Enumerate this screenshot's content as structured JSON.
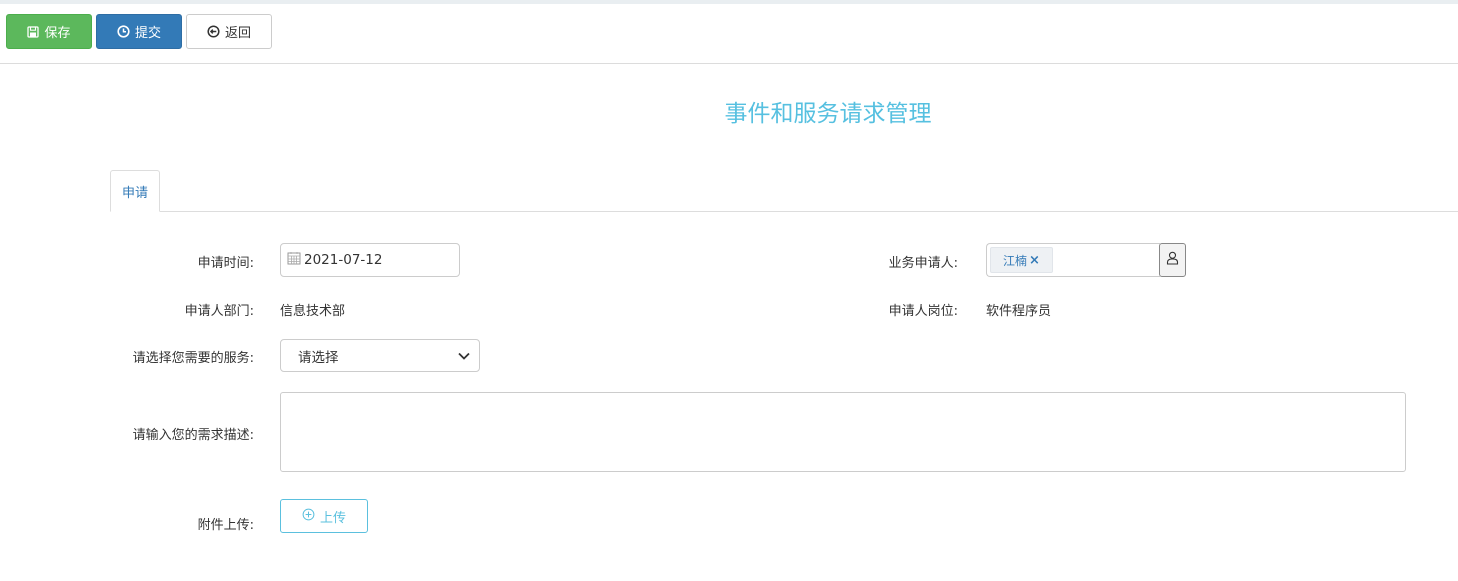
{
  "toolbar": {
    "save_label": "保存",
    "submit_label": "提交",
    "back_label": "返回"
  },
  "title": "事件和服务请求管理",
  "tabs": [
    {
      "label": "申请",
      "active": true
    }
  ],
  "form": {
    "apply_time": {
      "label": "申请时间:",
      "value": "2021-07-12"
    },
    "applicant": {
      "label": "业务申请人:",
      "tag": "江楠",
      "remove_glyph": "×"
    },
    "department": {
      "label": "申请人部门:",
      "value": "信息技术部"
    },
    "position": {
      "label": "申请人岗位:",
      "value": "软件程序员"
    },
    "service": {
      "label": "请选择您需要的服务:",
      "selected": "请选择"
    },
    "description": {
      "label": "请输入您的需求描述:",
      "value": ""
    },
    "attachment": {
      "label": "附件上传:",
      "button": "上传"
    }
  },
  "colors": {
    "save": "#5cb85c",
    "submit": "#337ab7",
    "title": "#56c0e0",
    "upload": "#5bc0de",
    "tab_text": "#337ab7"
  },
  "icons": {
    "save": "floppy-icon",
    "submit": "clock-icon",
    "back": "back-circle-icon",
    "date": "calendar-icon",
    "person": "user-icon",
    "select": "chevron-down-icon",
    "upload": "plus-circle-icon"
  }
}
